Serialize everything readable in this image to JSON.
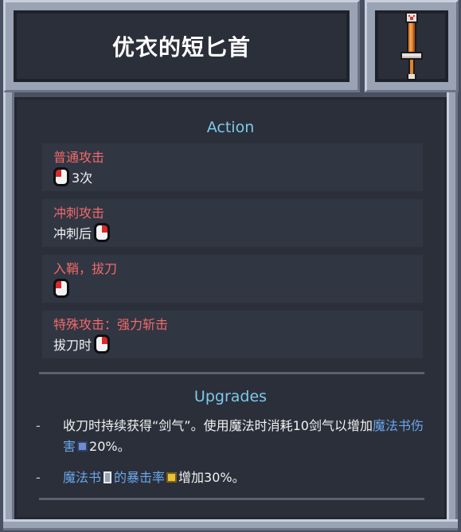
{
  "title": "优衣的短匕首",
  "item_icon": "dagger-icon",
  "action": {
    "heading": "Action",
    "items": [
      {
        "name": "普通攻击",
        "desc_after": "3次"
      },
      {
        "name": "冲刺攻击",
        "desc_before": "冲刺后"
      },
      {
        "name": "入鞘，拔刀"
      },
      {
        "name": "特殊攻击：强力斩击",
        "desc_before": "拔刀时"
      }
    ]
  },
  "upgrades": {
    "heading": "Upgrades",
    "rows": [
      {
        "dash": "-",
        "part1": "收刀时持续获得“剑气”。使用魔法时消耗10剑气以增加",
        "hl": "魔法书伤害",
        "part2": "20%。"
      },
      {
        "dash": "-",
        "hl1": "魔法书",
        "hl2": "的暴击率",
        "part2": "增加30%。"
      }
    ]
  },
  "colors": {
    "action_name": "#f06a6a",
    "heading": "#7cc9ea",
    "highlight": "#6aa6ea",
    "panel": "#2b2f3a"
  }
}
